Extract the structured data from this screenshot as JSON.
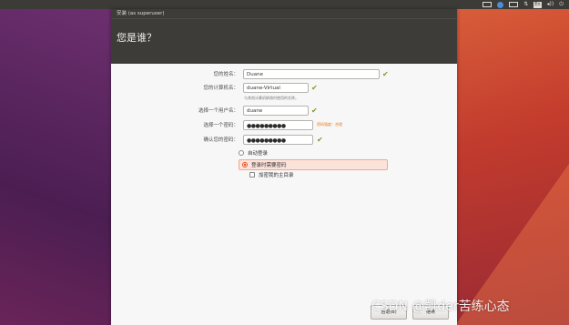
{
  "topbar": {
    "indicators": [
      "keyboard-icon",
      "bluetooth-icon",
      "battery-icon",
      "network-icon"
    ],
    "input_method": "En",
    "volume_icon": "◂))",
    "power_icon": "⏻"
  },
  "window": {
    "title": "安装 (as superuser)",
    "header": "您是谁？"
  },
  "form": {
    "name_label": "您的姓名：",
    "name_value": "Duane",
    "computer_label": "您的计算机名：",
    "computer_value": "duane-Virtual",
    "computer_hint": "与其他计算机联络时使用的名称。",
    "username_label": "选择一个用户名：",
    "username_value": "duane",
    "password_label": "选择一个密码：",
    "password_value": "●●●●●●●●●",
    "password_strength": "密码强度：合理",
    "confirm_label": "确认您的密码：",
    "confirm_value": "●●●●●●●●●",
    "check_mark": "✔"
  },
  "options": {
    "auto_login": "自动登录",
    "require_password": "登录时需要密码",
    "encrypt_home": "加密我的主目录"
  },
  "buttons": {
    "back": "后退(B)",
    "continue": "继续"
  },
  "watermark": "CSDN @凯der苦练心态"
}
